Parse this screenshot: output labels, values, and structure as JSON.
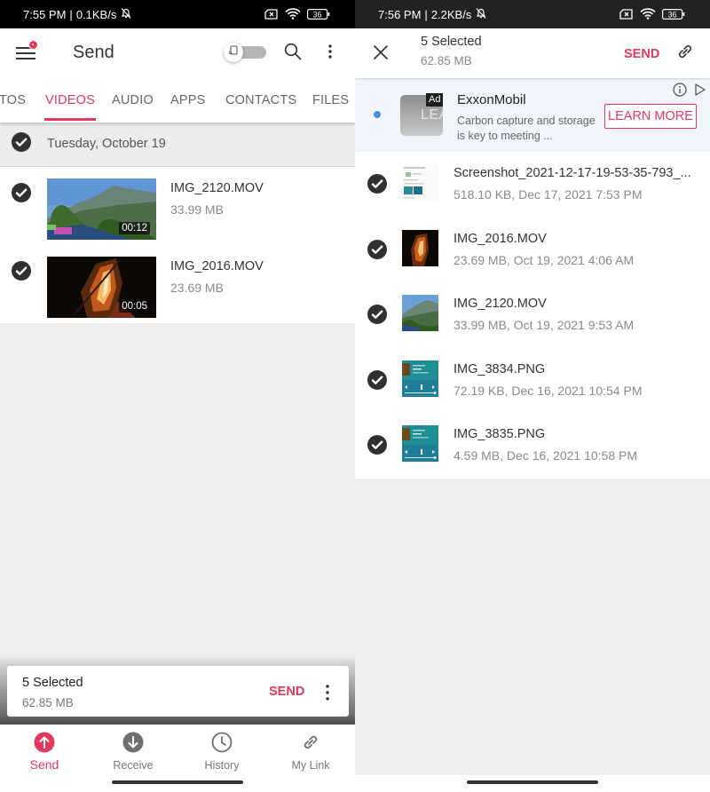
{
  "left_screen": {
    "status_bar": {
      "time": "7:55 PM",
      "speed": "0.1KB/s",
      "battery": "36"
    },
    "app_bar": {
      "title": "Send",
      "has_notification_badge": true
    },
    "tabs": [
      {
        "label": "TOS",
        "active": false
      },
      {
        "label": "VIDEOS",
        "active": true
      },
      {
        "label": "AUDIO",
        "active": false
      },
      {
        "label": "APPS",
        "active": false
      },
      {
        "label": "CONTACTS",
        "active": false
      },
      {
        "label": "FILES",
        "active": false
      }
    ],
    "date_group": {
      "label": "Tuesday, October 19",
      "checked": true
    },
    "videos": [
      {
        "name": "IMG_2120.MOV",
        "size": "33.99 MB",
        "duration": "00:12",
        "checked": true
      },
      {
        "name": "IMG_2016.MOV",
        "size": "23.69 MB",
        "duration": "00:05",
        "checked": true
      }
    ],
    "selection_card": {
      "count": "5 Selected",
      "size": "62.85 MB",
      "send_label": "SEND"
    },
    "bottom_nav": [
      {
        "label": "Send",
        "icon": "upload-circle-icon",
        "active": true
      },
      {
        "label": "Receive",
        "icon": "download-circle-icon",
        "active": false
      },
      {
        "label": "History",
        "icon": "clock-icon",
        "active": false
      },
      {
        "label": "My Link",
        "icon": "link-icon",
        "active": false
      }
    ]
  },
  "right_screen": {
    "status_bar": {
      "time": "7:56 PM",
      "speed": "2.2KB/s",
      "battery": "36"
    },
    "selection_bar": {
      "count": "5 Selected",
      "size": "62.85 MB",
      "send_label": "SEND"
    },
    "ad": {
      "badge": "Ad",
      "image_text": "LEA",
      "title": "ExxonMobil",
      "description": "Carbon capture and storage is key to meeting ...",
      "cta": "LEARN MORE"
    },
    "files": [
      {
        "name": "Screenshot_2021-12-17-19-53-35-793_...",
        "meta": "518.10 KB, Dec 17, 2021 7:53 PM",
        "type": "screenshot",
        "checked": true
      },
      {
        "name": "IMG_2016.MOV",
        "meta": "23.69 MB, Oct 19, 2021 4:06 AM",
        "type": "fire",
        "checked": true
      },
      {
        "name": "IMG_2120.MOV",
        "meta": "33.99 MB, Oct 19, 2021 9:53 AM",
        "type": "mountain",
        "checked": true
      },
      {
        "name": "IMG_3834.PNG",
        "meta": "72.19 KB, Dec 16, 2021 10:54 PM",
        "type": "player",
        "checked": true
      },
      {
        "name": "IMG_3835.PNG",
        "meta": "4.59 MB, Dec 16, 2021 10:58 PM",
        "type": "player",
        "checked": true
      }
    ]
  },
  "colors": {
    "accent": "#e4375e",
    "check": "#303030",
    "background": "#ededed",
    "ad_background": "#f1f5fb",
    "ad_dot": "#4a8de0"
  }
}
